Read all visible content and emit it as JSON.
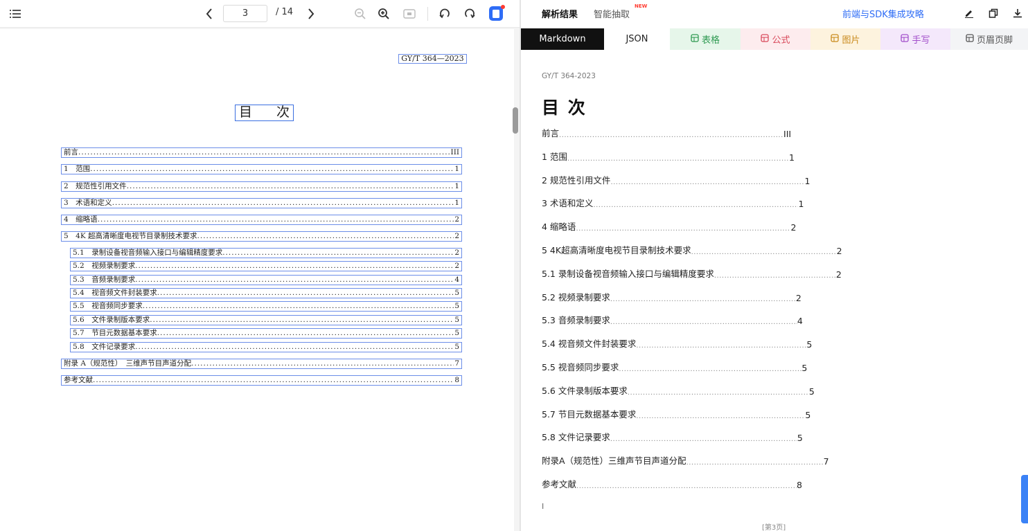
{
  "viewer": {
    "current_page": "3",
    "total_pages": "/ 14"
  },
  "document": {
    "standard_code": "GY/T 364—2023",
    "toc_title_left": "目",
    "toc_title_right": "次",
    "entries": [
      {
        "label": "前言",
        "page": "III"
      },
      {
        "label": "1　范围",
        "page": "1"
      },
      {
        "label": "2　规范性引用文件",
        "page": "1"
      },
      {
        "label": "3　术语和定义",
        "page": "1"
      },
      {
        "label": "4　缩略语",
        "page": "2"
      },
      {
        "label": "5　4K 超高清晰度电视节目录制技术要求",
        "page": "2"
      },
      {
        "label": "5.1　录制设备视音频输入接口与编辑精度要求",
        "page": "2"
      },
      {
        "label": "5.2　视频录制要求",
        "page": "2"
      },
      {
        "label": "5.3　音频录制要求",
        "page": "4"
      },
      {
        "label": "5.4　视音频文件封装要求",
        "page": "5"
      },
      {
        "label": "5.5　视音频同步要求",
        "page": "5"
      },
      {
        "label": "5.6　文件录制版本要求",
        "page": "5"
      },
      {
        "label": "5.7　节目元数据基本要求",
        "page": "5"
      },
      {
        "label": "5.8　文件记录要求",
        "page": "5"
      },
      {
        "label": "附录 A（规范性）　三维声节目声道分配",
        "page": "7"
      },
      {
        "label": "参考文献",
        "page": "8"
      }
    ]
  },
  "right_header": {
    "tab_result": "解析结果",
    "tab_extract": "智能抽取",
    "new_badge": "NEW",
    "sdk_link": "前端与SDK集成攻略"
  },
  "format_tabs": [
    {
      "label": "Markdown",
      "icon": ""
    },
    {
      "label": "JSON",
      "icon": ""
    },
    {
      "label": "表格",
      "icon": "table-icon"
    },
    {
      "label": "公式",
      "icon": "formula-icon"
    },
    {
      "label": "图片",
      "icon": "image-icon"
    },
    {
      "label": "手写",
      "icon": "handwriting-icon"
    },
    {
      "label": "页眉页脚",
      "icon": "header-footer-icon"
    }
  ],
  "markdown": {
    "code": "GY/T 364-2023",
    "heading": "目 次",
    "lines": [
      {
        "label": "前言",
        "page": "III"
      },
      {
        "label": "1 范围",
        "page": "1"
      },
      {
        "label": "2 规范性引用文件",
        "page": "1"
      },
      {
        "label": "3 术语和定义",
        "page": "1"
      },
      {
        "label": "4 缩略语",
        "page": "2"
      },
      {
        "label": "5 4K超高清晰度电视节目录制技术要求",
        "page": "2"
      },
      {
        "label": "5.1 录制设备视音频输入接口与编辑精度要求",
        "page": "2"
      },
      {
        "label": "5.2 视频录制要求",
        "page": "2"
      },
      {
        "label": "5.3 音频录制要求",
        "page": "4"
      },
      {
        "label": "5.4 视音频文件封装要求",
        "page": "5"
      },
      {
        "label": "5.5 视音频同步要求",
        "page": "5"
      },
      {
        "label": "5.6 文件录制版本要求",
        "page": "5"
      },
      {
        "label": "5.7 节目元数据基本要求",
        "page": "5"
      },
      {
        "label": "5.8 文件记录要求",
        "page": "5"
      },
      {
        "label": "附录A（规范性）三维声节目声道分配",
        "page": "7"
      },
      {
        "label": "参考文献",
        "page": "8"
      }
    ],
    "footer_mark": "I",
    "page_label": "[第3页]"
  },
  "colors": {
    "accent": "#2f6df6",
    "box_outline": "#6b8de8",
    "new_badge": "#ff3b30",
    "tab_markdown_bg": "#111111",
    "tab_table_bg": "#e6f6ea",
    "tab_formula_bg": "#fdecee",
    "tab_image_bg": "#fdf3de",
    "tab_handwriting_bg": "#f4e8fb",
    "tab_headerfooter_bg": "#f3f4f6"
  }
}
